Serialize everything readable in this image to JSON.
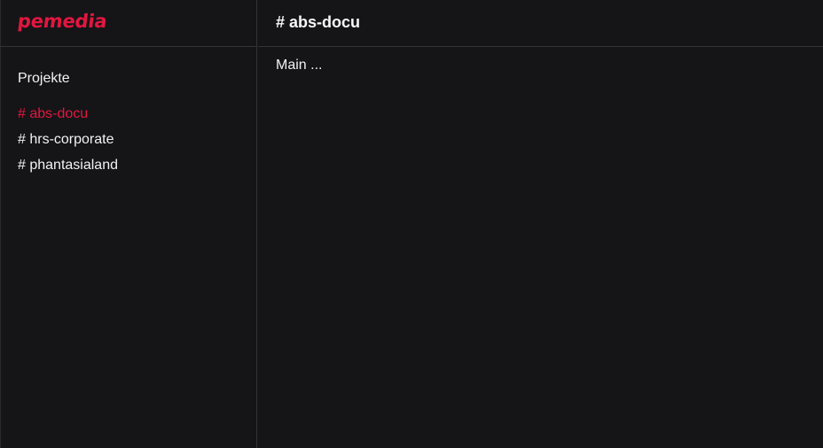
{
  "app": {
    "logo_text": "pemedia",
    "accent_color": "#e3163f",
    "background_color": "#151518"
  },
  "sidebar": {
    "section_title": "Projekte",
    "items": [
      {
        "label": "# abs-docu",
        "active": true
      },
      {
        "label": "# hrs-corporate",
        "active": false
      },
      {
        "label": "# phantasialand",
        "active": false
      }
    ]
  },
  "main": {
    "title": "# abs-docu",
    "content": "Main ..."
  }
}
